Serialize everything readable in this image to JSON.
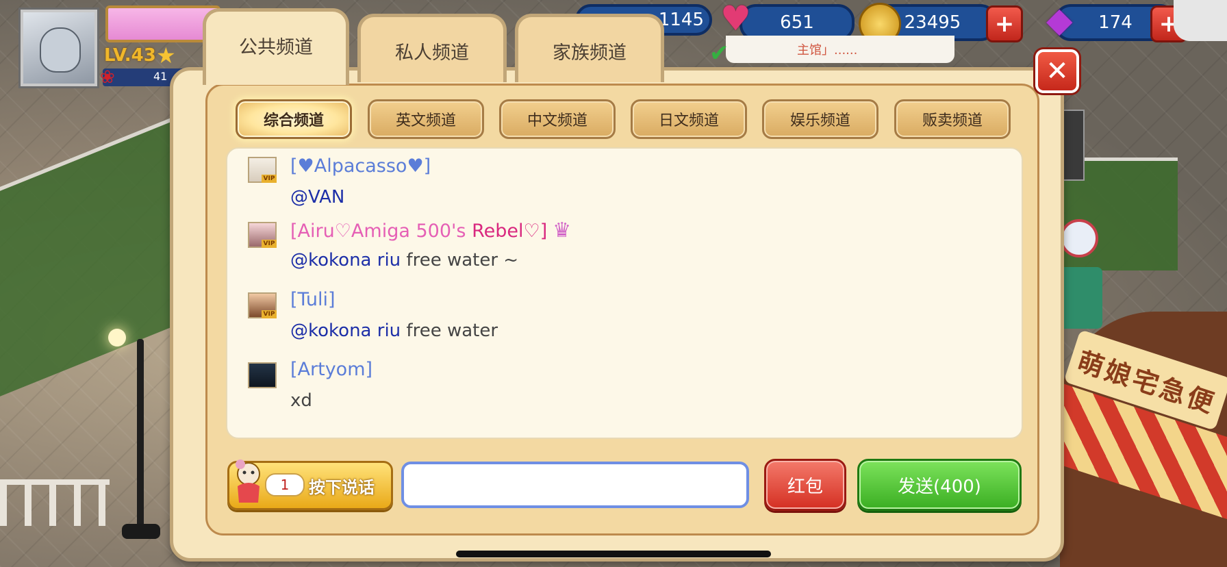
{
  "hud": {
    "level": "LV.43",
    "rose_count": "41",
    "stamina": "1145",
    "hearts": "651",
    "gold": "23495",
    "gems": "174",
    "notice_text": "主馆」......",
    "icons": [
      "heart-icon",
      "coin-icon",
      "diamond-icon",
      "plus-icon",
      "rose-icon",
      "star-icon"
    ]
  },
  "tabs": [
    {
      "label": "公共频道",
      "active": true
    },
    {
      "label": "私人频道",
      "active": false
    },
    {
      "label": "家族频道",
      "active": false
    }
  ],
  "subtabs": [
    {
      "label": "综合频道",
      "active": true
    },
    {
      "label": "英文频道",
      "active": false
    },
    {
      "label": "中文频道",
      "active": false
    },
    {
      "label": "日文频道",
      "active": false
    },
    {
      "label": "娱乐频道",
      "active": false
    },
    {
      "label": "贩卖频道",
      "active": false
    }
  ],
  "messages": [
    {
      "name": "[♥Alpacasso♥]",
      "mention": "@VAN",
      "text": "",
      "vip": true
    },
    {
      "name_prefix": "[Airu♡Amiga 500's ",
      "name_suffix": "Rebel♡]",
      "mention": "@kokona riu",
      "text": " free water ~",
      "vip": true
    },
    {
      "name": "[Tuli]",
      "mention": "@kokona riu",
      "text": " free water",
      "vip": true
    },
    {
      "name": "[Artyom]",
      "mention": "",
      "text": "xd",
      "vip": false
    }
  ],
  "vip_badge": "VIP",
  "controls": {
    "voice_count": "1",
    "voice_label": "按下说话",
    "input_value": "",
    "redpack_label": "红包",
    "send_label": "发送(400)"
  },
  "colors": {
    "mention": "#1d2fa8",
    "name_blue": "#5b7dd8",
    "name_pink": "#e55fb5",
    "send_green": "#3aae22",
    "redpack_red": "#d42f22"
  }
}
